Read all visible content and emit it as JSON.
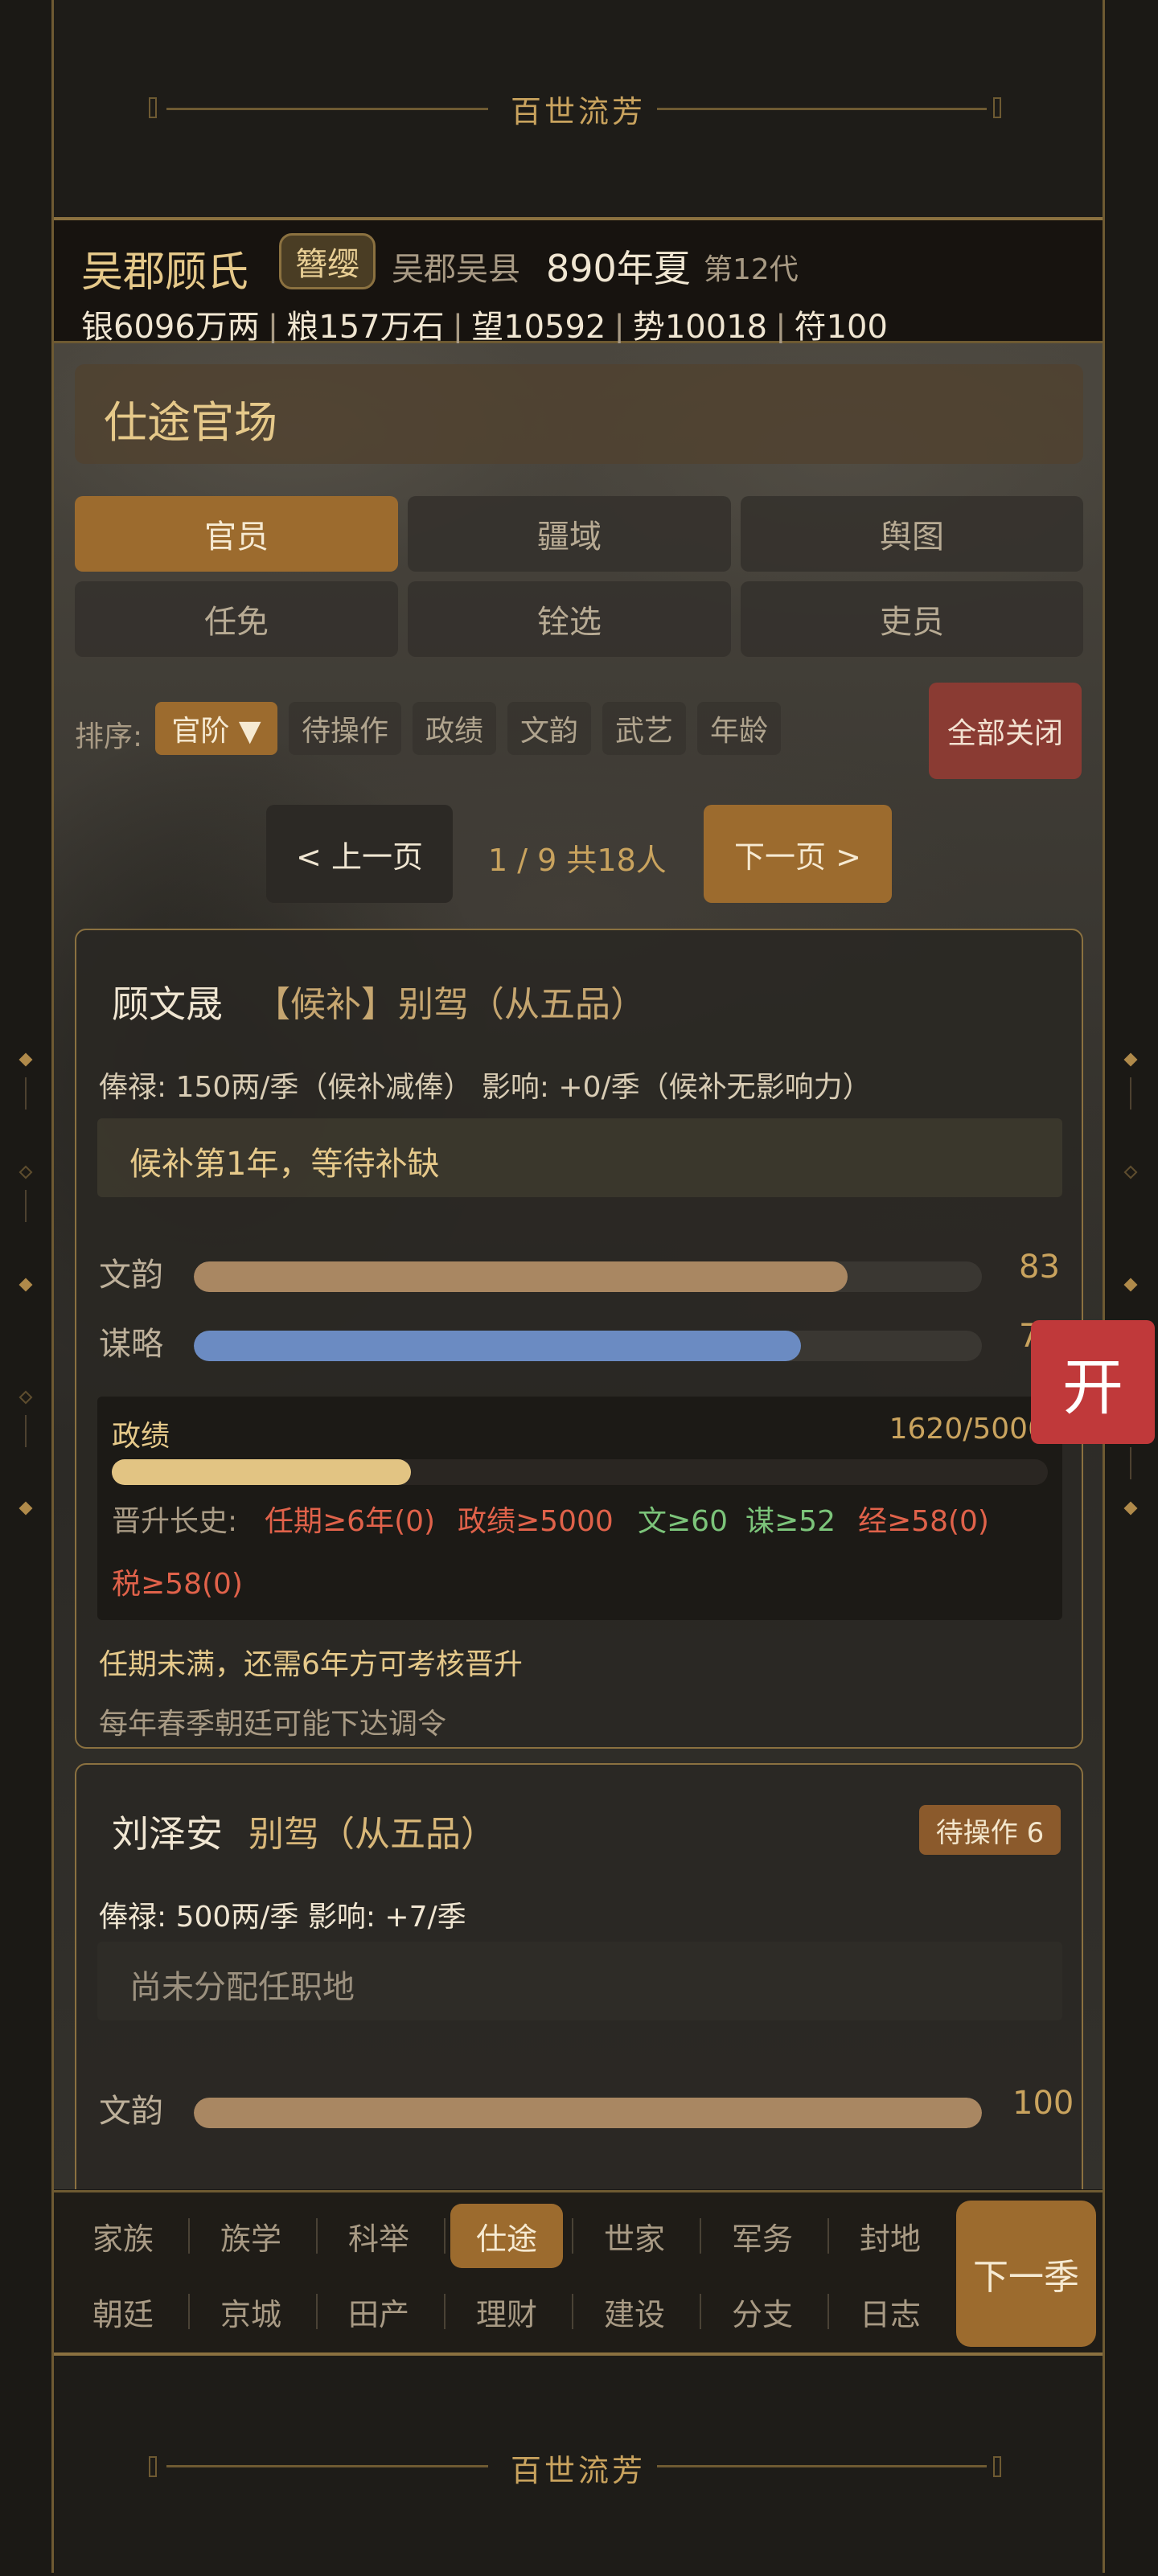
{
  "banner": {
    "title": "百世流芳"
  },
  "family": {
    "name": "吴郡顾氏",
    "title": "簪缨",
    "place": "吴郡吴县",
    "date": "890年夏",
    "generation": "第12代",
    "stats": [
      "银6096万两",
      "粮157万石",
      "望10592",
      "势10018",
      "符100"
    ]
  },
  "panel": {
    "title": "仕途官场"
  },
  "tabs": [
    "官员",
    "疆域",
    "舆图",
    "任免",
    "铨选",
    "吏员"
  ],
  "sort": {
    "label": "排序:",
    "options": [
      "官阶 ▼",
      "待操作",
      "政绩",
      "文韵",
      "武艺",
      "年龄"
    ],
    "close_all": "全部关闭"
  },
  "pagination": {
    "prev": "< 上一页",
    "info": "1 / 9  共18人",
    "next": "下一页 >"
  },
  "officials": [
    {
      "name": "顾文晟",
      "status": "【候补】",
      "rank": "别驾（从五品）",
      "salary_line": "俸禄: 150两/季（候补减俸）   影响: +0/季（候补无影响力）",
      "notice": "候补第1年，等待补缺",
      "stats": [
        {
          "label": "文韵",
          "value": 83,
          "color": "#a98762"
        },
        {
          "label": "谋略",
          "value": 77,
          "color": "#6b8bc2"
        }
      ],
      "merit": {
        "label": "政绩",
        "value": "1620/5000",
        "fraction": 0.32
      },
      "promotion": {
        "prefix": "晋升长史:",
        "reqs": [
          {
            "text": "任期≥6年(0)",
            "ok": false
          },
          {
            "text": "政绩≥5000",
            "ok": false
          },
          {
            "text": "文≥60",
            "ok": true
          },
          {
            "text": "谋≥52",
            "ok": true
          },
          {
            "text": "经≥58(0)",
            "ok": false
          },
          {
            "text": "税≥58(0)",
            "ok": false
          }
        ]
      },
      "warning": "任期未满，还需6年方可考核晋升",
      "hint": "每年春季朝廷可能下达调令"
    },
    {
      "name": "刘泽安",
      "rank": "别驾（从五品）",
      "pending": "待操作 6",
      "salary_line": "俸禄: 500两/季   影响: +7/季",
      "notice": "尚未分配任职地",
      "stats": [
        {
          "label": "文韵",
          "value": 100,
          "color": "#a98762"
        }
      ]
    }
  ],
  "nav": {
    "row1": [
      "家族",
      "族学",
      "科举",
      "仕途",
      "世家",
      "军务",
      "封地"
    ],
    "row2": [
      "朝廷",
      "京城",
      "田产",
      "理财",
      "建设",
      "分支",
      "日志"
    ],
    "active": "仕途",
    "next_season": "下一季"
  },
  "floating": {
    "open": "开"
  },
  "colors": {
    "gold": "#c9a35e",
    "accent": "#9c6b2e",
    "ok": "#7cc47a",
    "bad": "#e0624a",
    "warn": "#e6c98a"
  }
}
